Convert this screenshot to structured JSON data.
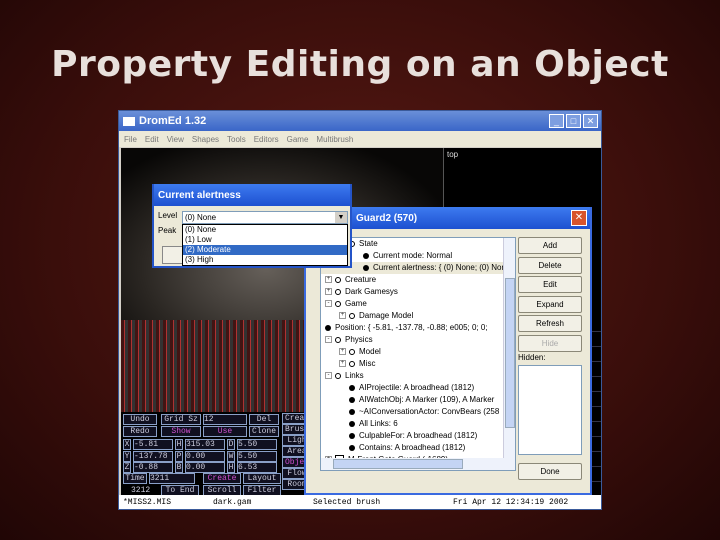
{
  "slide_title": "Property Editing on an Object",
  "window": {
    "title": "DromEd  1.32",
    "menu": [
      "File",
      "Edit",
      "View",
      "Shapes",
      "Tools",
      "Editors",
      "Game",
      "Multibrush"
    ],
    "viewport_label": "top"
  },
  "controls": {
    "undo": "Undo",
    "redo": "Redo",
    "grid_sz": "Grid Sz",
    "grid_val": "12",
    "del": "Del",
    "show": "Show",
    "use": "Use",
    "clone": "Clone",
    "x": "X",
    "x_val": "-5.81",
    "h": "H",
    "h_val": "315.03",
    "d": "D",
    "d_val": "5.50",
    "y": "Y",
    "y_val": "-137.78",
    "p": "P",
    "p_val": "0.00",
    "w": "W",
    "w_val": "5.50",
    "z": "Z",
    "z_val": "-0.88",
    "b": "B",
    "b_val": "0.00",
    "hh": "H",
    "hh_val": "6.53",
    "time": "Time",
    "time_val": "3211",
    "create": "Create",
    "layout": "Layout",
    "frame": "3212",
    "to_end": "To End",
    "scroll": "Scroll",
    "filter": "Filter",
    "side": [
      "Creat",
      "Brush",
      "Ligh",
      "Area",
      "Objec",
      "Flow",
      "Room"
    ]
  },
  "status": {
    "file": "*MISS2.MIS",
    "gamesys": "dark.gam",
    "selected": "Selected brush",
    "datetime": "Fri Apr 12 12:34:19 2002"
  },
  "alert_dialog": {
    "title": "Current alertness",
    "level_label": "Level",
    "peak_label": "Peak",
    "level_value": "(0) None",
    "options": [
      "(0) None",
      "(1) Low",
      "(2) Moderate",
      "(3) High"
    ],
    "highlighted": "(2) Moderate"
  },
  "prop_dialog": {
    "title": "Guard2 (570)",
    "tree": [
      {
        "t": "State",
        "i": "ring",
        "d": 1,
        "ex": ""
      },
      {
        "t": "Current mode: Normal",
        "i": "dot",
        "d": 2,
        "ex": ""
      },
      {
        "t": "Current alertness: { (0) None; (0) None",
        "i": "dot",
        "d": 2,
        "ex": ""
      },
      {
        "t": "Creature",
        "i": "ring",
        "d": 0,
        "ex": "+"
      },
      {
        "t": "Dark Gamesys",
        "i": "ring",
        "d": 0,
        "ex": "+"
      },
      {
        "t": "Game",
        "i": "ring",
        "d": 0,
        "ex": "-"
      },
      {
        "t": "Damage Model",
        "i": "ring",
        "d": 1,
        "ex": "+"
      },
      {
        "t": "Position: { -5.81, -137.78, -0.88; e005; 0; 0;",
        "i": "dot",
        "d": 0,
        "ex": ""
      },
      {
        "t": "Physics",
        "i": "ring",
        "d": 0,
        "ex": "-"
      },
      {
        "t": "Model",
        "i": "ring",
        "d": 1,
        "ex": "+"
      },
      {
        "t": "Misc",
        "i": "ring",
        "d": 1,
        "ex": "+"
      },
      {
        "t": "Links",
        "i": "ring",
        "d": 0,
        "ex": "-"
      },
      {
        "t": "AIProjectile: A broadhead (1812)",
        "i": "dot",
        "d": 1,
        "ex": ""
      },
      {
        "t": "AIWatchObj: A Marker (109), A Marker",
        "i": "dot",
        "d": 1,
        "ex": ""
      },
      {
        "t": "~AIConversationActor: ConvBears (258",
        "i": "dot",
        "d": 1,
        "ex": ""
      },
      {
        "t": "All Links: 6",
        "i": "dot",
        "d": 1,
        "ex": ""
      },
      {
        "t": "CulpableFor: A broadhead (1812)",
        "i": "dot",
        "d": 1,
        "ex": ""
      },
      {
        "t": "Contains: A broadhead (1812)",
        "i": "dot",
        "d": 1,
        "ex": ""
      },
      {
        "t": "M-Front Gate Guard (-1689)",
        "i": "cube",
        "d": 0,
        "ex": "+"
      }
    ],
    "buttons": [
      "Add",
      "Delete",
      "Edit",
      "Expand",
      "Refresh",
      "Hide"
    ],
    "hidden_label": "Hidden:",
    "done": "Done"
  }
}
